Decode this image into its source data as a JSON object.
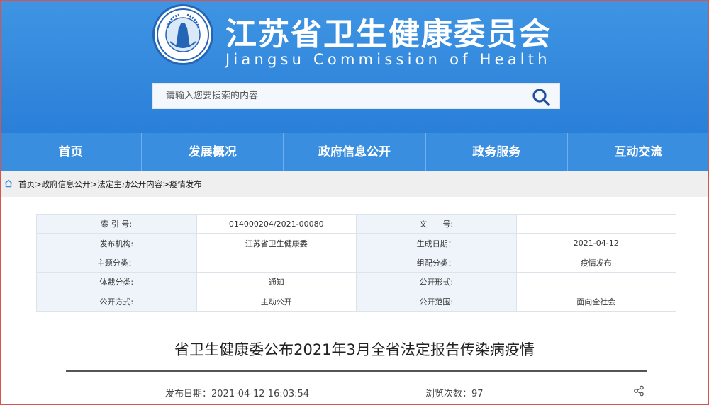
{
  "header": {
    "title_cn": "江苏省卫生健康委员会",
    "title_en": "Jiangsu Commission of Health",
    "emblem_text": "Jiangsu Commission of Health",
    "search_placeholder": "请输入您要搜索的内容",
    "colors": {
      "header_bg": "#2a7fd8",
      "nav_bg": "#3a8ee0"
    }
  },
  "nav": [
    {
      "label": "首页"
    },
    {
      "label": "发展概况"
    },
    {
      "label": "政府信息公开"
    },
    {
      "label": "政务服务"
    },
    {
      "label": "互动交流"
    }
  ],
  "breadcrumb": [
    {
      "label": "首页>"
    },
    {
      "label": "政府信息公开>"
    },
    {
      "label": "法定主动公开内容>"
    },
    {
      "label": "疫情发布"
    }
  ],
  "meta": [
    [
      {
        "k": "索 引 号:",
        "v": "014000204/2021-00080"
      },
      {
        "k": "文　　号:",
        "v": ""
      }
    ],
    [
      {
        "k": "发布机构:",
        "v": "江苏省卫生健康委"
      },
      {
        "k": "生成日期：",
        "v": "2021-04-12"
      }
    ],
    [
      {
        "k": "主题分类：",
        "v": ""
      },
      {
        "k": "组配分类：",
        "v": "疫情发布"
      }
    ],
    [
      {
        "k": "体裁分类:",
        "v": "通知"
      },
      {
        "k": "公开形式:",
        "v": ""
      }
    ],
    [
      {
        "k": "公开方式:",
        "v": "主动公开"
      },
      {
        "k": "公开范围:",
        "v": "面向全社会"
      }
    ]
  ],
  "article": {
    "title": "省卫生健康委公布2021年3月全省法定报告传染病疫情",
    "publish": "发布日期：2021-04-12 16:03:54",
    "views": "浏览次数：97"
  }
}
